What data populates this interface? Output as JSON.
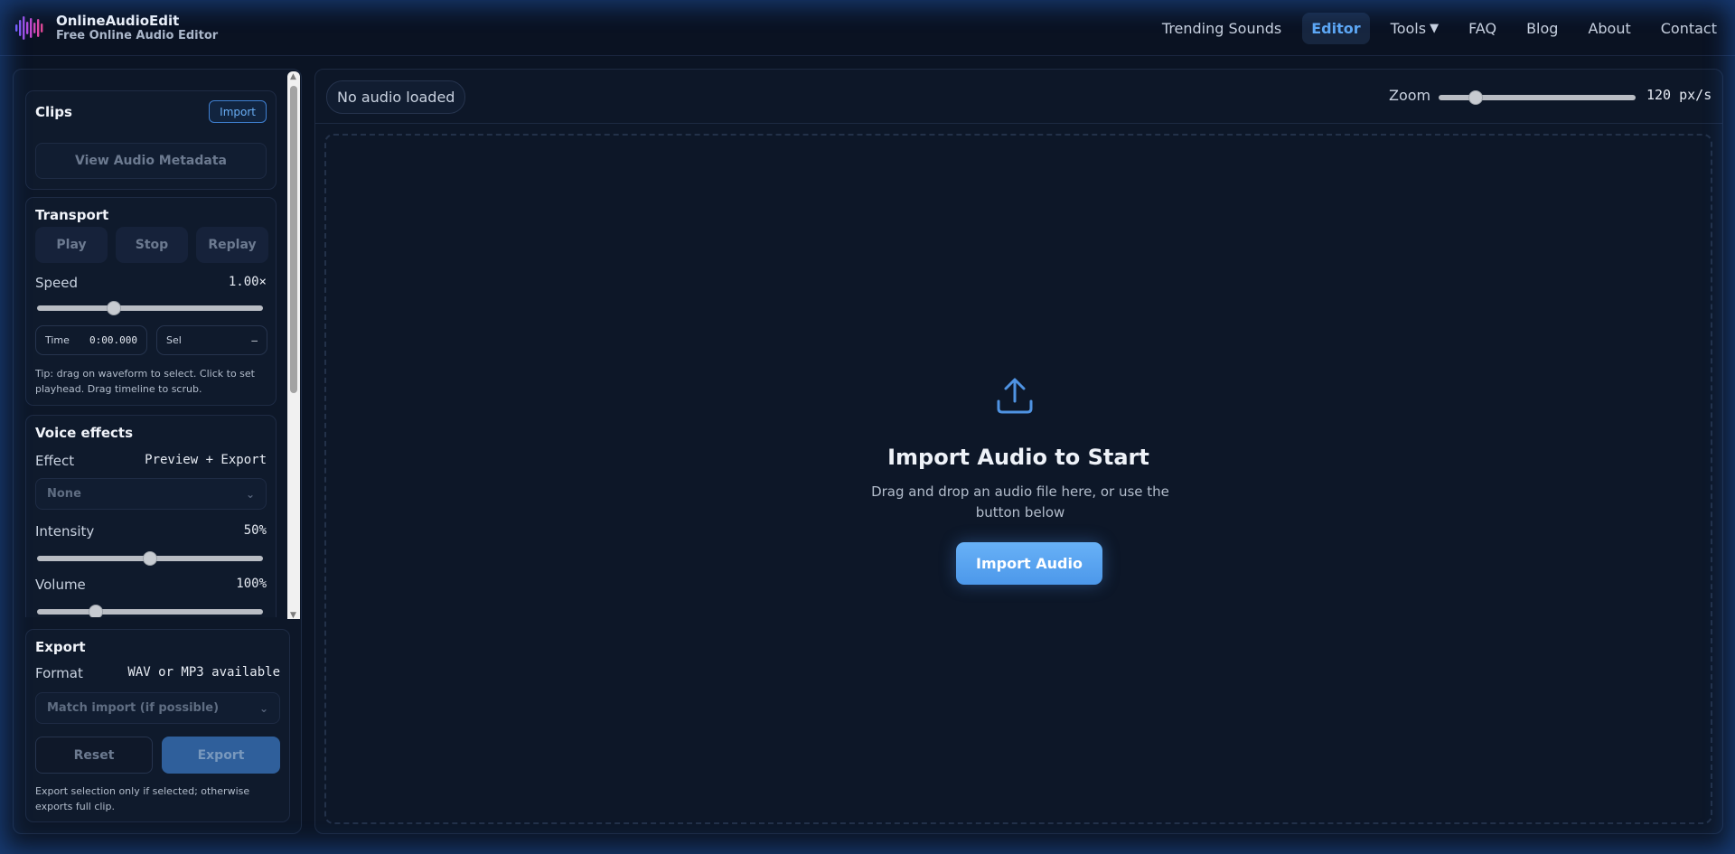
{
  "brand": {
    "name": "OnlineAudioEdit",
    "subtitle": "Free Online Audio Editor",
    "logo_colors": [
      "#7a5cff",
      "#b44be1",
      "#e04896"
    ]
  },
  "nav": {
    "items": [
      {
        "label": "Trending Sounds"
      },
      {
        "label": "Editor",
        "active": true
      },
      {
        "label": "Tools",
        "caret": "▼"
      },
      {
        "label": "FAQ"
      },
      {
        "label": "Blog"
      },
      {
        "label": "About"
      },
      {
        "label": "Contact"
      }
    ]
  },
  "clips": {
    "title": "Clips",
    "import_label": "Import",
    "metadata_label": "View Audio Metadata"
  },
  "transport": {
    "title": "Transport",
    "play_label": "Play",
    "stop_label": "Stop",
    "replay_label": "Replay",
    "speed_label": "Speed",
    "speed_value": "1.00×",
    "speed_level": 0.34,
    "time_label": "Time",
    "time_value": "0:00.000",
    "sel_label": "Sel",
    "sel_value": "–",
    "tip": "Tip: drag on waveform to select. Click to set playhead. Drag timeline to scrub."
  },
  "voice_effects": {
    "title": "Voice effects",
    "effect_label": "Effect",
    "effect_mode": "Preview + Export",
    "effect_selected": "None",
    "intensity_label": "Intensity",
    "intensity_value": "50%",
    "intensity_level": 0.5,
    "volume_label": "Volume",
    "volume_value": "100%",
    "volume_level": 0.26
  },
  "export": {
    "title": "Export",
    "format_label": "Format",
    "format_value": "WAV or MP3 available",
    "format_selected": "Match import (if possible)",
    "reset_label": "Reset",
    "export_label": "Export",
    "note": "Export selection only if selected; otherwise exports full clip."
  },
  "toolbar": {
    "status": "No audio loaded",
    "zoom_label": "Zoom",
    "zoom_value": "120 px/s",
    "zoom_level": 0.19
  },
  "dropzone": {
    "icon": "upload-icon",
    "title": "Import Audio to Start",
    "description": "Drag and drop an audio file here, or use the button below",
    "button_label": "Import Audio"
  },
  "colors": {
    "accent": "#5ea8f5",
    "background": "#0b1424",
    "panel": "#0d1728"
  }
}
